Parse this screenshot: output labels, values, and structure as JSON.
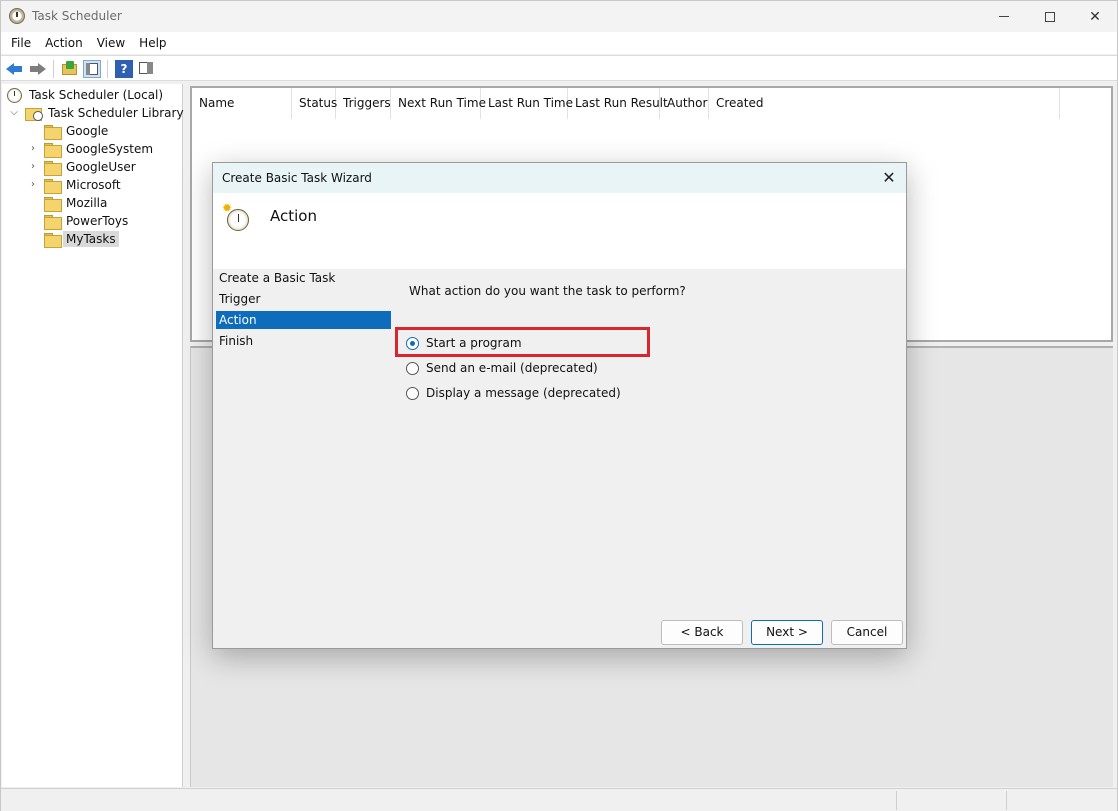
{
  "window": {
    "title": "Task Scheduler"
  },
  "menu": [
    "File",
    "Action",
    "View",
    "Help"
  ],
  "toolbar": {
    "help_glyph": "?"
  },
  "tree": {
    "root": "Task Scheduler (Local)",
    "library": "Task Scheduler Library",
    "folders": [
      "Google",
      "GoogleSystem",
      "GoogleUser",
      "Microsoft",
      "Mozilla",
      "PowerToys",
      "MyTasks"
    ],
    "selected": "MyTasks"
  },
  "grid": {
    "columns": [
      "Name",
      "Status",
      "Triggers",
      "Next Run Time",
      "Last Run Time",
      "Last Run Result",
      "Author",
      "Created"
    ]
  },
  "dialog": {
    "title": "Create Basic Task Wizard",
    "close_glyph": "✕",
    "header_title": "Action",
    "steps": [
      "Create a Basic Task",
      "Trigger",
      "Action",
      "Finish"
    ],
    "active_step": "Action",
    "question": "What action do you want the task to perform?",
    "options": [
      "Start a program",
      "Send an e-mail (deprecated)",
      "Display a message (deprecated)"
    ],
    "selected_option": "Start a program",
    "buttons": {
      "back": "< Back",
      "next": "Next >",
      "cancel": "Cancel"
    }
  },
  "colors": {
    "accent": "#0f6cbd",
    "highlight": "#d8262e"
  }
}
